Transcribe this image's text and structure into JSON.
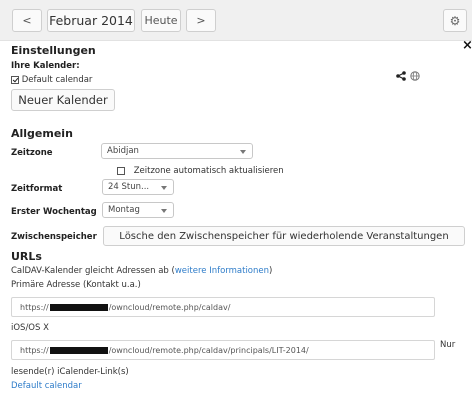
{
  "toolbar": {
    "prev": "<",
    "month": "Februar 2014",
    "today": "Heute",
    "next": ">",
    "settings_icon": "gear-icon"
  },
  "settings": {
    "title": "Einstellungen",
    "close": "×",
    "your_calendars": "Ihre Kalender:",
    "default_calendar_label": "Default calendar",
    "default_calendar_checked": true,
    "share_icon": "share-icon",
    "globe_icon": "globe-icon",
    "new_calendar_button": "Neuer Kalender"
  },
  "general": {
    "title": "Allgemein",
    "timezone_label": "Zeitzone",
    "timezone_value": "Abidjan",
    "timezone_auto_label": "Zeitzone automatisch aktualisieren",
    "timezone_auto_checked": false,
    "timeformat_label": "Zeitformat",
    "timeformat_value": "24 Stun...",
    "firstday_label": "Erster Wochentag",
    "firstday_value": "Montag",
    "cache_label": "Zwischenspeicher",
    "cache_button": "Lösche den Zwischenspeicher für wiederholende Veranstaltungen"
  },
  "urls": {
    "title": "URLs",
    "caldav_text": "CalDAV-Kalender gleicht Adressen ab (",
    "caldav_link": "weitere Informationen",
    "caldav_close": ")",
    "primary_label": "Primäre Adresse (Kontakt u.a.)",
    "primary_prefix": "https://",
    "primary_suffix": "/owncloud/remote.php/caldav/",
    "ios_label": "iOS/OS X",
    "ios_prefix": "https://",
    "ios_suffix": "/owncloud/remote.php/caldav/principals/LIT-2014/",
    "readonly_nur": "Nur",
    "readonly_label": "lesende(r) iCalender-Link(s)",
    "readonly_link": "Default calendar"
  }
}
